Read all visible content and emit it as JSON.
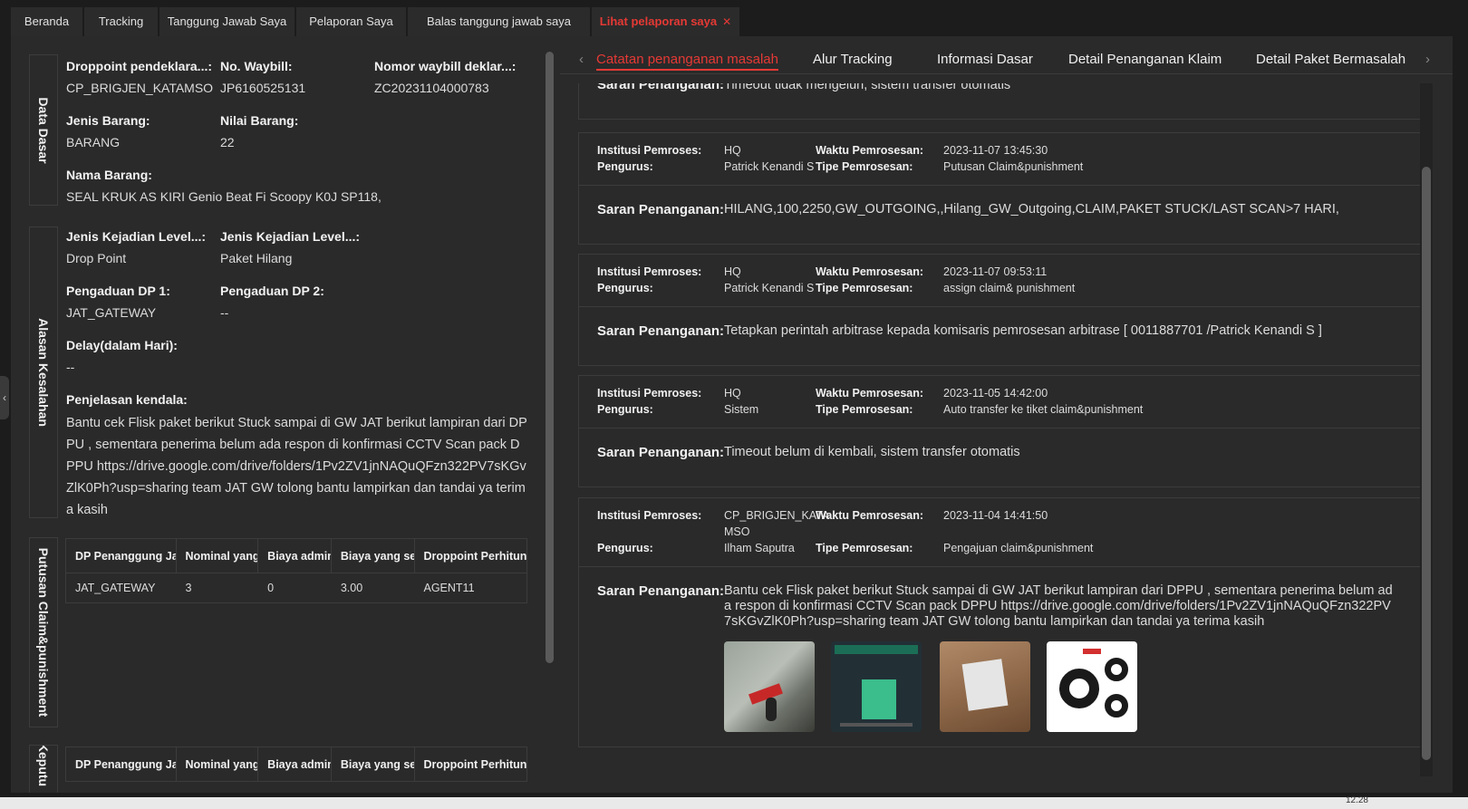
{
  "top_tabs": [
    {
      "label": "Beranda"
    },
    {
      "label": "Tracking"
    },
    {
      "label": "Tanggung Jawab Saya"
    },
    {
      "label": "Pelaporan Saya"
    },
    {
      "label": "Balas tanggung jawab saya"
    },
    {
      "label": "Lihat pelaporan saya",
      "active": true
    }
  ],
  "left": {
    "sections": {
      "data_dasar": "Data Dasar",
      "alasan": "Alasan Kesalahan",
      "putusan": "Putusan Claim&punishment",
      "keputusan": "Keputu"
    },
    "fields": {
      "droppoint_label": "Droppoint pendeklara...:",
      "droppoint_value": "CP_BRIGJEN_KATAMSO",
      "waybill_label": "No. Waybill:",
      "waybill_value": "JP6160525131",
      "nomor_label": "Nomor waybill deklar...:",
      "nomor_value": "ZC20231104000783",
      "jenis_label": "Jenis Barang:",
      "jenis_value": "BARANG",
      "nilai_label": "Nilai Barang:",
      "nilai_value": "22",
      "nama_label": "Nama Barang:",
      "nama_value": "SEAL KRUK AS KIRI Genio Beat Fi Scoopy K0J SP118,",
      "level1_label": "Jenis Kejadian Level...:",
      "level1_value": "Drop Point",
      "level2_label": "Jenis Kejadian Level...:",
      "level2_value": "Paket Hilang",
      "dp1_label": "Pengaduan DP 1:",
      "dp1_value": "JAT_GATEWAY",
      "dp2_label": "Pengaduan DP 2:",
      "dp2_value": "--",
      "delay_label": "Delay(dalam Hari):",
      "delay_value": "--",
      "penjelasan_label": "Penjelasan kendala:",
      "penjelasan_value": "Bantu cek Flisk paket berikut Stuck sampai di GW JAT berikut lampiran dari DPPU , sementara penerima belum ada respon di konfirmasi CCTV Scan pack DPPU https://drive.google.com/drive/folders/1Pv2ZV1jnNAQuQFzn322PV7sKGvZlK0Ph?usp=sharing team JAT GW tolong bantu lampirkan dan tandai ya terima kasih"
    },
    "table_headers": [
      "DP Penanggung Jawab",
      "Nominal yang",
      "Biaya admin",
      "Biaya yang seharusnya",
      "Droppoint Perhitungan"
    ],
    "table_row": [
      "JAT_GATEWAY",
      "3",
      "0",
      "3.00",
      "AGENT11"
    ],
    "table2_headers": [
      "DP Penanggung Jawab",
      "Nominal yang",
      "Biaya admin",
      "Biaya yang seharusnya",
      "Droppoint Perhitungan"
    ]
  },
  "right": {
    "tabs": [
      {
        "label": "Catatan penanganan masalah",
        "active": true
      },
      {
        "label": "Alur Tracking"
      },
      {
        "label": "Informasi Dasar"
      },
      {
        "label": "Detail Penanganan Klaim"
      },
      {
        "label": "Detail Paket Bermasalah"
      }
    ],
    "labels": {
      "institusi": "Institusi Pemroses:",
      "pengurus": "Pengurus:",
      "waktu": "Waktu Pemrosesan:",
      "tipe": "Tipe Pemrosesan:",
      "saran": "Saran Penanganan:"
    },
    "records": [
      {
        "saran": "Timeout tidak mengeluh, sistem transfer otomatis"
      },
      {
        "institusi": "HQ",
        "pengurus": "Patrick Kenandi S",
        "waktu": "2023-11-07 13:45:30",
        "tipe": "Putusan Claim&punishment",
        "saran": "HILANG,100,2250,GW_OUTGOING,,Hilang_GW_Outgoing,CLAIM,PAKET STUCK/LAST SCAN>7 HARI,"
      },
      {
        "institusi": "HQ",
        "pengurus": "Patrick Kenandi S",
        "waktu": "2023-11-07 09:53:11",
        "tipe": "assign claim& punishment",
        "saran": "Tetapkan perintah arbitrase kepada komisaris pemrosesan arbitrase [ 0011887701 /Patrick Kenandi S ]"
      },
      {
        "institusi": "HQ",
        "pengurus": "Sistem",
        "waktu": "2023-11-05 14:42:00",
        "tipe": "Auto transfer ke tiket claim&punishment",
        "saran": "Timeout belum di kembali, sistem transfer otomatis"
      },
      {
        "institusi_line1": "CP_BRIGJEN_KATA",
        "institusi_line2": "MSO",
        "pengurus": "Ilham Saputra",
        "waktu": "2023-11-04 14:41:50",
        "tipe": "Pengajuan claim&punishment",
        "saran": "Bantu cek Flisk paket berikut Stuck sampai di GW JAT berikut lampiran dari DPPU , sementara penerima belum ada respon di konfirmasi CCTV Scan pack DPPU https://drive.google.com/drive/folders/1Pv2ZV1jnNAQuQFzn322PV7sKGvZlK0Ph?usp=sharing team JAT GW tolong bantu lampirkan dan tandai ya terima kasih"
      }
    ]
  },
  "taskbar": {
    "clock": "12.28"
  },
  "colors": {
    "accent": "#e53935",
    "panel": "#2a2a2a",
    "background": "#1c1c1c"
  }
}
